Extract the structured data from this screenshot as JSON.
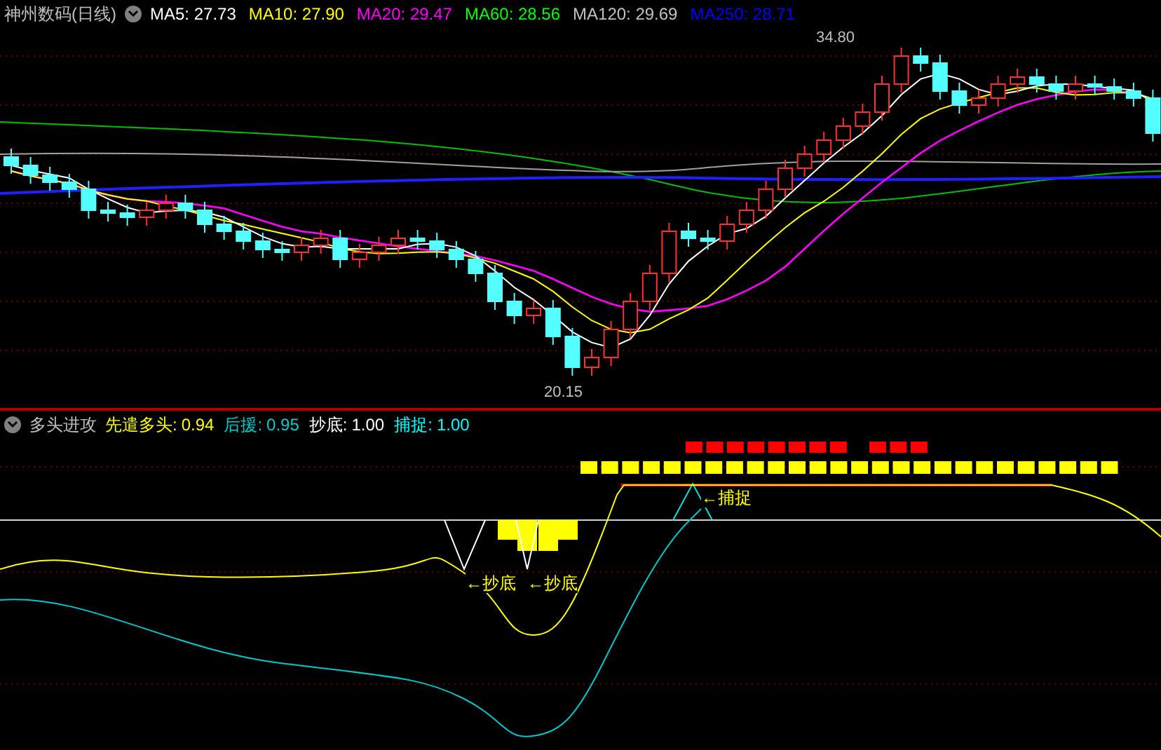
{
  "main_chart": {
    "title": "神州数码(日线)",
    "legend": [
      {
        "label": "MA5: 27.73",
        "color": "#ffffff"
      },
      {
        "label": "MA10: 27.90",
        "color": "#ffff00"
      },
      {
        "label": "MA20: 29.47",
        "color": "#ff00ff"
      },
      {
        "label": "MA60: 28.56",
        "color": "#00ff00"
      },
      {
        "label": "MA120: 29.69",
        "color": "#c0c0c0"
      },
      {
        "label": "MA250: 28.71",
        "color": "#0000ff"
      }
    ],
    "high_label": "34.80",
    "low_label": "20.15"
  },
  "indicator": {
    "title": "多头进攻",
    "legend": [
      {
        "name": "先遣多头:",
        "value": "0.94",
        "color": "#ffff00"
      },
      {
        "name": "后援:",
        "value": "0.95",
        "color": "#00cccc"
      },
      {
        "name": "抄底:",
        "value": "1.00",
        "color": "#ffffff"
      },
      {
        "name": "捕捉:",
        "value": "1.00",
        "color": "#00ffff"
      }
    ],
    "markers": [
      {
        "text": "←抄底"
      },
      {
        "text": "←抄底"
      },
      {
        "text": "←捕捉"
      }
    ]
  }
}
